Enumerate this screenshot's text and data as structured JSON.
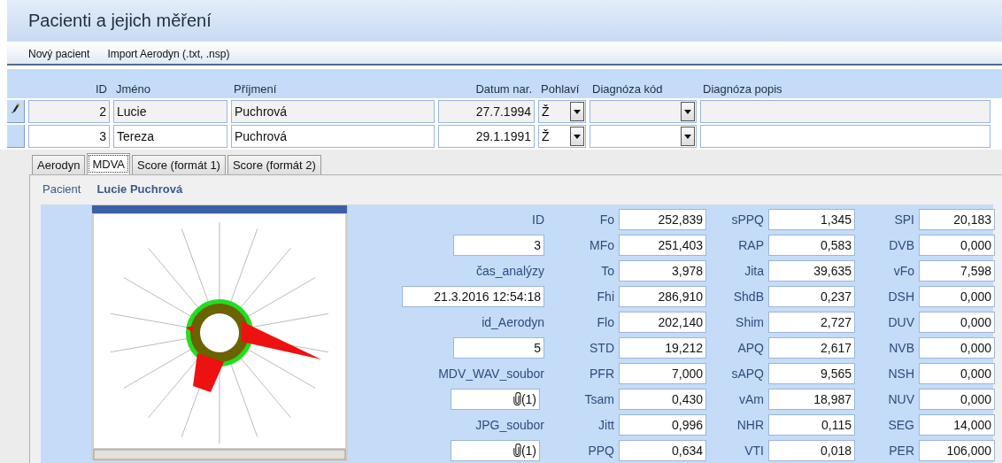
{
  "window": {
    "title": "Pacienti a jejich měření"
  },
  "toolbar": [
    {
      "label": "Nový pacient"
    },
    {
      "label": "Import Aerodyn (.txt, .nsp)"
    }
  ],
  "grid": {
    "columns": [
      "ID",
      "Jméno",
      "Příjmení",
      "Datum nar.",
      "Pohlaví",
      "Diagnóza kód",
      "Diagnóza popis"
    ],
    "rows": [
      {
        "id": "2",
        "first_name": "Lucie",
        "last_name": "Puchrová",
        "birth_date": "27.7.1994",
        "sex": "Ž",
        "selected": true,
        "editing": true
      },
      {
        "id": "3",
        "first_name": "Tereza",
        "last_name": "Puchrová",
        "birth_date": "29.1.1991",
        "sex": "Ž",
        "selected": false,
        "editing": false
      }
    ]
  },
  "tabs": [
    {
      "label": "Aerodyn",
      "selected": false
    },
    {
      "label": "MDVA",
      "selected": true
    },
    {
      "label": "Score (formát 1)",
      "selected": false
    },
    {
      "label": "Score (formát 2)",
      "selected": false
    }
  ],
  "patient": {
    "label": "Pacient",
    "name": "Lucie Puchrová"
  },
  "record_fields": [
    {
      "label": "ID",
      "value": "3",
      "kind": "text"
    },
    {
      "label": "čas_analýzy",
      "value": "21.3.2016 12:54:18",
      "kind": "datetime"
    },
    {
      "label": "id_Aerodyn",
      "value": "5",
      "kind": "text"
    },
    {
      "label": "MDV_WAV_soubor",
      "value": "(1)",
      "kind": "attachment"
    },
    {
      "label": "JPG_soubor",
      "value": "(1)",
      "kind": "attachment"
    }
  ],
  "measures": [
    {
      "label": "Fo",
      "value": "252,839"
    },
    {
      "label": "MFo",
      "value": "251,403"
    },
    {
      "label": "To",
      "value": "3,978"
    },
    {
      "label": "Fhi",
      "value": "286,910"
    },
    {
      "label": "Flo",
      "value": "202,140"
    },
    {
      "label": "STD",
      "value": "19,212"
    },
    {
      "label": "PFR",
      "value": "7,000"
    },
    {
      "label": "Tsam",
      "value": "0,430"
    },
    {
      "label": "Jitt",
      "value": "0,996"
    },
    {
      "label": "PPQ",
      "value": "0,634"
    },
    {
      "label": "sPPQ",
      "value": "1,345"
    },
    {
      "label": "RAP",
      "value": "0,583"
    },
    {
      "label": "Jita",
      "value": "39,635"
    },
    {
      "label": "ShdB",
      "value": "0,237"
    },
    {
      "label": "Shim",
      "value": "2,727"
    },
    {
      "label": "APQ",
      "value": "2,617"
    },
    {
      "label": "sAPQ",
      "value": "9,565"
    },
    {
      "label": "vAm",
      "value": "18,987"
    },
    {
      "label": "NHR",
      "value": "0,115"
    },
    {
      "label": "VTI",
      "value": "0,018"
    },
    {
      "label": "SPI",
      "value": "20,183"
    },
    {
      "label": "DVB",
      "value": "0,000"
    },
    {
      "label": "vFo",
      "value": "7,598"
    },
    {
      "label": "DSH",
      "value": "0,000"
    },
    {
      "label": "DUV",
      "value": "0,000"
    },
    {
      "label": "NVB",
      "value": "0,000"
    },
    {
      "label": "NSH",
      "value": "0,000"
    },
    {
      "label": "NUV",
      "value": "0,000"
    },
    {
      "label": "SEG",
      "value": "14,000"
    },
    {
      "label": "PER",
      "value": "106,000"
    }
  ]
}
